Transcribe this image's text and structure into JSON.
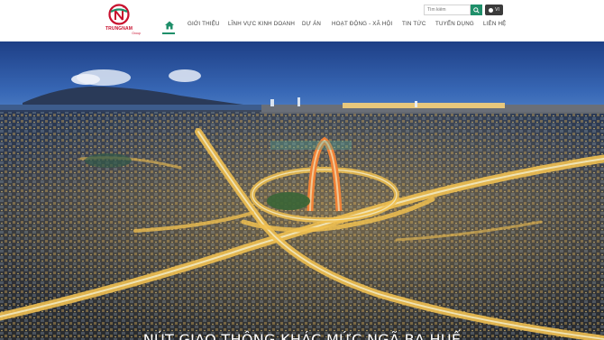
{
  "brand": {
    "name": "TRUNGNAM",
    "sub": "Group",
    "colors": {
      "red": "#c8102e",
      "green": "#1f8f6a"
    }
  },
  "search": {
    "placeholder": "Tìm kiếm",
    "icon": "search-icon"
  },
  "language": {
    "label": "VI",
    "icon": "globe-icon"
  },
  "nav": {
    "home_icon": "home-icon",
    "items": [
      {
        "label": "GIỚI THIỆU"
      },
      {
        "label": "LĨNH VỰC KINH DOANH"
      },
      {
        "label": "DỰ ÁN"
      },
      {
        "label": "HOẠT ĐỘNG - XÃ HỘI"
      },
      {
        "label": "TIN TỨC"
      },
      {
        "label": "TUYỂN DỤNG"
      },
      {
        "label": "LIÊN HỆ"
      }
    ]
  },
  "hero": {
    "caption": "NÚT GIAO THÔNG KHÁC MỨC NGÃ BA HUẾ"
  }
}
